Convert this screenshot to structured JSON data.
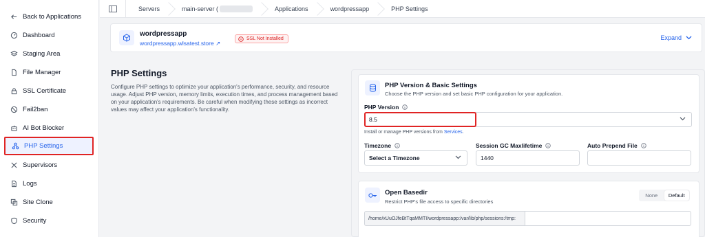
{
  "sidebar": {
    "items": [
      {
        "label": "Back to Applications",
        "icon": "arrow-left-icon"
      },
      {
        "label": "Dashboard",
        "icon": "dashboard-icon"
      },
      {
        "label": "Staging Area",
        "icon": "layers-icon"
      },
      {
        "label": "File Manager",
        "icon": "file-icon"
      },
      {
        "label": "SSL Certificate",
        "icon": "lock-icon"
      },
      {
        "label": "Fail2ban",
        "icon": "ban-icon"
      },
      {
        "label": "AI Bot Blocker",
        "icon": "robot-icon"
      },
      {
        "label": "PHP Settings",
        "icon": "php-icon",
        "active": true
      },
      {
        "label": "Supervisors",
        "icon": "tools-icon"
      },
      {
        "label": "Logs",
        "icon": "logs-icon"
      },
      {
        "label": "Site Clone",
        "icon": "clone-icon"
      },
      {
        "label": "Security",
        "icon": "shield-icon"
      }
    ]
  },
  "breadcrumb": {
    "items": [
      "Servers",
      "main-server (",
      "Applications",
      "wordpressapp",
      "PHP Settings"
    ]
  },
  "app": {
    "name": "wordpressapp",
    "domain": "wordpressapp.wlsatest.store ↗",
    "ssl_status": "SSL Not Installed",
    "expand_label": "Expand"
  },
  "section": {
    "title": "PHP Settings",
    "description": "Configure PHP settings to optimize your application's performance, security, and resource usage. Adjust PHP version, memory limits, execution times, and process management based on your application's requirements. Be careful when modifying these settings as incorrect values may affect your application's functionality."
  },
  "version_card": {
    "title": "PHP Version & Basic Settings",
    "subtitle": "Choose the PHP version and set basic PHP configuration for your application.",
    "php_version_label": "PHP Version",
    "php_version_value": "8.5",
    "hint_text": "Install or manage PHP versions from ",
    "hint_link": "Services",
    "hint_end": ".",
    "timezone_label": "Timezone",
    "timezone_value": "Select a Timezone",
    "gc_label": "Session GC Maxlifetime",
    "gc_value": "1440",
    "prepend_label": "Auto Prepend File",
    "prepend_value": ""
  },
  "basedir_card": {
    "title": "Open Basedir",
    "subtitle": "Restrict PHP's file access to specific directories",
    "toggle_none": "None",
    "toggle_default": "Default",
    "path_prefix": "/home/xUuOJfeBtTqaMMTI/wordpressapp:/var/lib/php/sessions:/tmp:",
    "path_value": ""
  },
  "colors": {
    "accent": "#2563eb",
    "highlight": "#e02424",
    "ssl_red": "#dc2626"
  }
}
